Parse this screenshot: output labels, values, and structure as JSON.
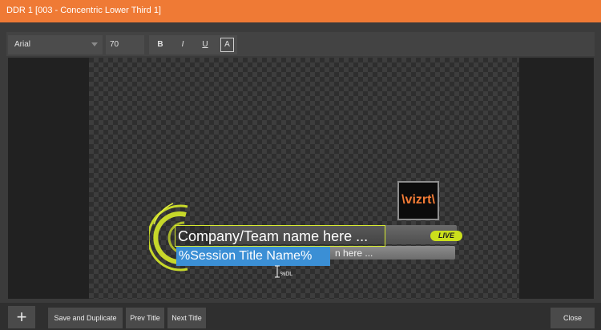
{
  "window": {
    "title": "DDR 1  [003 - Concentric Lower Third 1]"
  },
  "toolbar": {
    "font": "Arial",
    "size": "70",
    "bold": "B",
    "italic": "I",
    "underline": "U",
    "align": "A"
  },
  "preview": {
    "company_text": "Company/Team name here ...",
    "session_text": "%Session Title Name%",
    "subtitle_text": "n here ...",
    "live_badge": "LIVE",
    "logo_text": "\\vizrt\\",
    "cursor_label": "%DL"
  },
  "footer": {
    "add_label": "+",
    "save_dup_label": "Save and Duplicate",
    "prev_label": "Prev Title",
    "next_label": "Next Title",
    "close_label": "Close"
  },
  "colors": {
    "title_bar": "#ef7a35",
    "accent_yellow": "#d8ec2e",
    "selection_blue": "#3b8fd5",
    "logo_orange": "#f57c36"
  },
  "icons": {
    "add": "plus-icon",
    "logo": "vizrt-logo"
  }
}
